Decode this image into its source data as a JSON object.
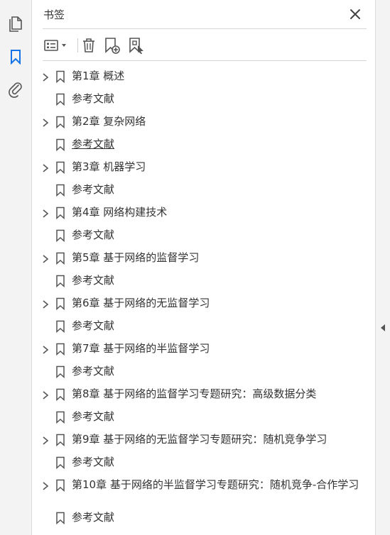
{
  "panel": {
    "title": "书签"
  },
  "rail": {
    "icons": [
      "pages-icon",
      "bookmark-icon",
      "attachment-icon"
    ]
  },
  "toolbar": {
    "icons": [
      "options-menu-icon",
      "delete-icon",
      "new-bookmark-icon",
      "new-bookmark-from-structure-icon"
    ]
  },
  "bookmarks": [
    {
      "label": "第1章 概述",
      "expandable": true
    },
    {
      "label": "参考文献",
      "expandable": false
    },
    {
      "label": "第2章 复杂网络",
      "expandable": true
    },
    {
      "label": "参考文献",
      "expandable": false
    },
    {
      "label": "第3章 机器学习",
      "expandable": true
    },
    {
      "label": "参考文献",
      "expandable": false
    },
    {
      "label": "第4章 网络构建技术",
      "expandable": true
    },
    {
      "label": "参考文献",
      "expandable": false
    },
    {
      "label": "第5章 基于网络的监督学习",
      "expandable": true
    },
    {
      "label": "参考文献",
      "expandable": false
    },
    {
      "label": "第6章 基于网络的无监督学习",
      "expandable": true
    },
    {
      "label": "参考文献",
      "expandable": false
    },
    {
      "label": "第7章 基于网络的半监督学习",
      "expandable": true
    },
    {
      "label": "参考文献",
      "expandable": false
    },
    {
      "label": "第8章 基于网络的监督学习专题研究：高级数据分类",
      "expandable": true
    },
    {
      "label": "参考文献",
      "expandable": false
    },
    {
      "label": "第9章 基于网络的无监督学习专题研究：随机竞争学习",
      "expandable": true
    },
    {
      "label": "参考文献",
      "expandable": false
    },
    {
      "label": "第10章 基于网络的半监督学习专题研究：随机竞争-合作学习",
      "expandable": true
    },
    {
      "label": "参考文献",
      "expandable": false
    }
  ],
  "colors": {
    "accent": "#1473e6",
    "icon": "#555555"
  }
}
